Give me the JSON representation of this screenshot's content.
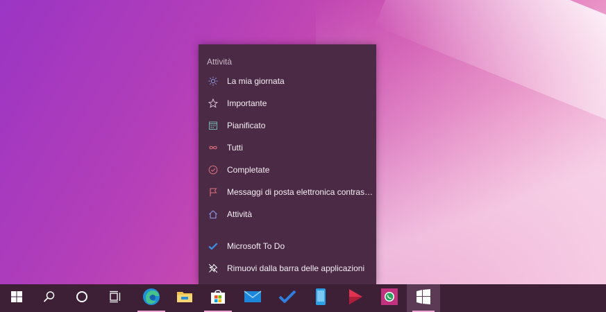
{
  "jump_list": {
    "header": "Attività",
    "items": [
      {
        "label": "La mia giornata",
        "icon": "sun-icon",
        "color": "#8e9be6"
      },
      {
        "label": "Importante",
        "icon": "star-icon",
        "color": "#c9b8c6"
      },
      {
        "label": "Pianificato",
        "icon": "calendar-icon",
        "color": "#6fb7b0"
      },
      {
        "label": "Tutti",
        "icon": "infinity-icon",
        "color": "#e0707b"
      },
      {
        "label": "Completate",
        "icon": "check-circle-icon",
        "color": "#e0707b"
      },
      {
        "label": "Messaggi di posta elettronica contrass...",
        "icon": "flag-icon",
        "color": "#e0707b"
      },
      {
        "label": "Attività",
        "icon": "home-icon",
        "color": "#8e9be6"
      }
    ],
    "app_items": [
      {
        "label": "Microsoft To Do",
        "icon": "todo-check-icon",
        "color": "#3a8ee6"
      },
      {
        "label": "Rimuovi dalla barra delle applicazioni",
        "icon": "unpin-icon",
        "color": "#ffffff"
      }
    ]
  },
  "taskbar": {
    "buttons": [
      {
        "name": "start-button",
        "icon": "windows-logo-icon"
      },
      {
        "name": "search-button",
        "icon": "search-icon"
      },
      {
        "name": "cortana-button",
        "icon": "cortana-circle-icon"
      },
      {
        "name": "task-view-button",
        "icon": "task-view-icon"
      },
      {
        "name": "edge-button",
        "icon": "edge-icon"
      },
      {
        "name": "file-explorer-button",
        "icon": "folder-icon"
      },
      {
        "name": "store-button",
        "icon": "store-bag-icon"
      },
      {
        "name": "mail-button",
        "icon": "mail-icon"
      },
      {
        "name": "todo-button",
        "icon": "todo-check-icon"
      },
      {
        "name": "phone-button",
        "icon": "phone-icon"
      },
      {
        "name": "media-button",
        "icon": "play-icon"
      },
      {
        "name": "whatsapp-button",
        "icon": "whatsapp-icon"
      },
      {
        "name": "snap-button",
        "icon": "window-snap-icon"
      }
    ],
    "accent_color": "#f0a8d6"
  }
}
